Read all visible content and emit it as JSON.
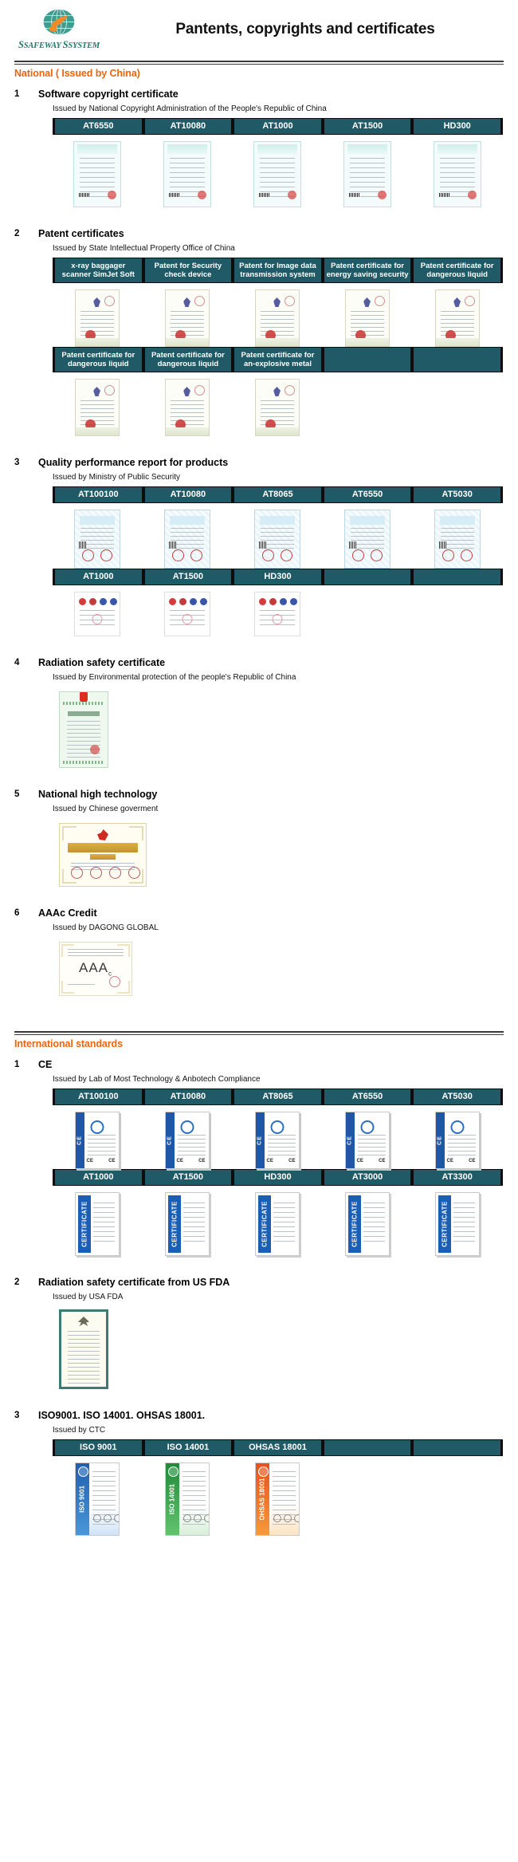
{
  "header": {
    "logo_brand_safeway": "SAFEWAY",
    "logo_brand_system": "SYSTEM",
    "title": "Pantents, copyrights and certificates"
  },
  "sections": [
    {
      "id": "national",
      "title": "National ( Issued by China)",
      "items": [
        {
          "num": "1",
          "name": "Software copyright certificate",
          "issuer": "Issued by National Copyright Administration of the People's Republic of China",
          "tables": [
            {
              "cells": [
                "AT6550",
                "AT10080",
                "AT1000",
                "AT1500",
                "HD300"
              ],
              "thumb": "copyright",
              "thumb_count": 5
            }
          ]
        },
        {
          "num": "2",
          "name": "Patent certificates",
          "issuer": "Issued by State Intellectual Property Office of China",
          "tables": [
            {
              "cells": [
                "x-ray baggager scanner SimJet Soft",
                "Patent for Security check device",
                "Patent for Image data transmission system",
                "Patent certificate for energy saving security",
                "Patent certificate for dangerous liquid"
              ],
              "thumb": "patent",
              "thumb_count": 5
            },
            {
              "cells": [
                "Patent certificate for dangerous liquid",
                "Patent certificate for dangerous liquid",
                "Patent certificate for an-explosive metal",
                "",
                ""
              ],
              "thumb": "patent",
              "thumb_count": 3
            }
          ]
        },
        {
          "num": "3",
          "name": "Quality performance report for products",
          "issuer": "Issued by Ministry of Public Security",
          "tables": [
            {
              "cells": [
                "AT100100",
                "AT10080",
                "AT8065",
                "AT6550",
                "AT5030"
              ],
              "thumb": "quality",
              "thumb_count": 5
            },
            {
              "cells": [
                "AT1000",
                "AT1500",
                "HD300",
                "",
                ""
              ],
              "thumb": "mark",
              "thumb_count": 3
            }
          ]
        },
        {
          "num": "4",
          "name": "Radiation safety certificate",
          "issuer": "Issued by Environmental protection of the people's Republic of China",
          "tables": [],
          "single_thumb": "radiation"
        },
        {
          "num": "5",
          "name": "National high technology",
          "issuer": "Issued by Chinese goverment",
          "tables": [],
          "single_thumb": "hightech"
        },
        {
          "num": "6",
          "name": "AAAc Credit",
          "issuer": "Issued by DAGONG GLOBAL",
          "tables": [],
          "single_thumb": "aaa",
          "aaa_grade": "AAA"
        }
      ]
    },
    {
      "id": "international",
      "title": "International standards",
      "items": [
        {
          "num": "1",
          "name": "CE",
          "issuer": "Issued by Lab of Most Technology & Anbotech Compliance",
          "tables": [
            {
              "cells": [
                "AT100100",
                "AT10080",
                "AT8065",
                "AT6550",
                "AT5030"
              ],
              "thumb": "ce",
              "thumb_count": 5
            },
            {
              "cells": [
                "AT1000",
                "AT1500",
                "HD300",
                "AT3000",
                "AT3300"
              ],
              "thumb": "certbanner",
              "thumb_count": 5
            }
          ]
        },
        {
          "num": "2",
          "name": "Radiation safety certificate from US FDA",
          "issuer": "Issued by USA FDA",
          "tables": [],
          "single_thumb": "fda"
        },
        {
          "num": "3",
          "name": "ISO9001. ISO 14001. OHSAS 18001.",
          "issuer": "Issued by CTC",
          "tables": [
            {
              "cells": [
                "ISO 9001",
                "ISO 14001",
                "OHSAS 18001",
                "",
                ""
              ],
              "thumb": "iso",
              "thumb_count": 3
            }
          ]
        }
      ]
    }
  ],
  "cert_labels": {
    "ce_mark": "CE",
    "ce_spine": "CE",
    "certificate_banner": "CERTIFICATE",
    "iso_9001": "ISO 9001",
    "iso_14001": "ISO 14001",
    "ohsas_18001": "OHSAS 18001"
  },
  "colors": {
    "table_header_bg": "#1f5a66",
    "section_title": "#f0630a",
    "logo_teal": "#2e8b80",
    "logo_orange": "#e8862a",
    "rule": "#3a3a3a"
  }
}
